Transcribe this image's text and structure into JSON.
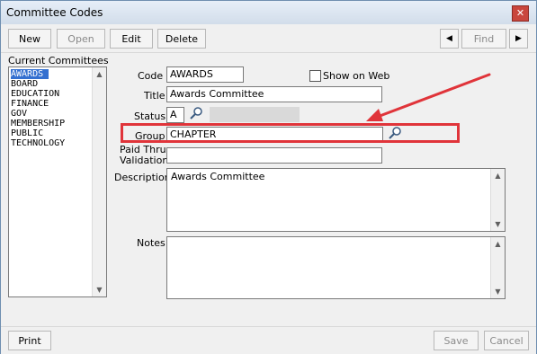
{
  "window": {
    "title": "Committee Codes",
    "close_glyph": "✕"
  },
  "toolbar": {
    "new_label": "New",
    "open_label": "Open",
    "edit_label": "Edit",
    "delete_label": "Delete",
    "prev_glyph": "◀",
    "find_label": "Find",
    "next_glyph": "▶"
  },
  "list": {
    "header": "Current Committees",
    "items": [
      "AWARDS",
      "BOARD",
      "EDUCATION",
      "FINANCE",
      "GOV",
      "MEMBERSHIP",
      "PUBLIC",
      "TECHNOLOGY"
    ],
    "selected_index": 0
  },
  "form": {
    "code_label": "Code",
    "code_value": "AWARDS",
    "show_on_web_label": "Show on Web",
    "show_on_web_checked": false,
    "title_label": "Title",
    "title_value": "Awards Committee",
    "status_label": "Status",
    "status_value": "A",
    "group_label": "Group",
    "group_value": "CHAPTER",
    "paid_thru_label_1": "Paid Thru",
    "paid_thru_label_2": "Validation",
    "paid_thru_value": "",
    "description_label": "Description",
    "description_value": "Awards Committee",
    "notes_label": "Notes",
    "notes_value": ""
  },
  "footer": {
    "print_label": "Print",
    "save_label": "Save",
    "cancel_label": "Cancel"
  },
  "annotation": {
    "color": "#e0343a"
  },
  "icons": {
    "lookup": "magnifier-icon",
    "scroll_up": "▲",
    "scroll_down": "▼"
  }
}
